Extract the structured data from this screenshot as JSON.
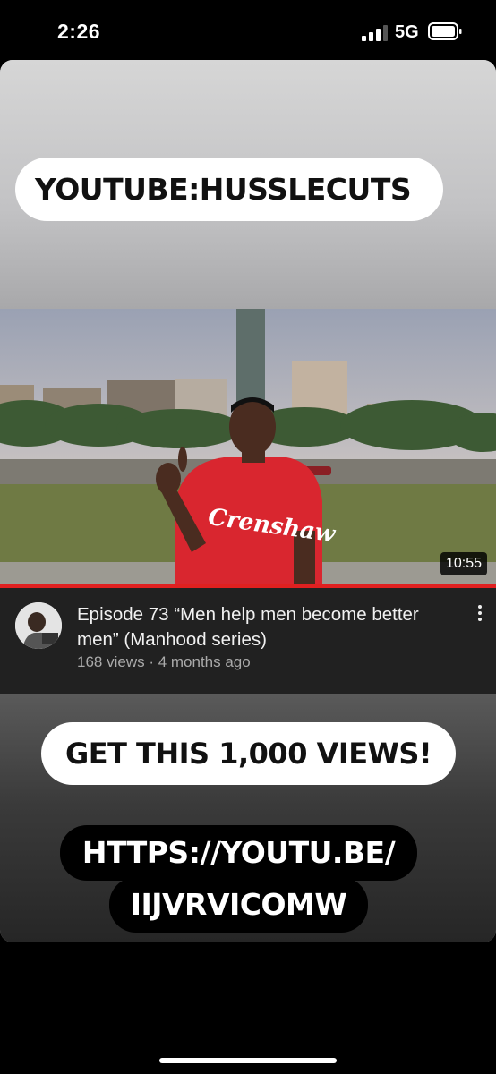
{
  "status_bar": {
    "time": "2:26",
    "network": "5G"
  },
  "story": {
    "channel_caption": "YOUTUBE:HUSSLECUTS",
    "cta_caption": "GET THIS 1,000 VIEWS!",
    "link_line_1": "HTTPS://YOUTU.BE/",
    "link_line_2": "IIJVRVICOMW"
  },
  "video": {
    "duration": "10:55",
    "title": "Episode 73 “Men help men become better men” (Manhood series)",
    "meta": "168 views · 4 months ago",
    "shirt_text": "Crenshaw",
    "progress_color": "#e02020"
  },
  "icons": {
    "signal": "cellular-signal-icon",
    "battery": "battery-icon",
    "more": "more-vertical-icon"
  }
}
